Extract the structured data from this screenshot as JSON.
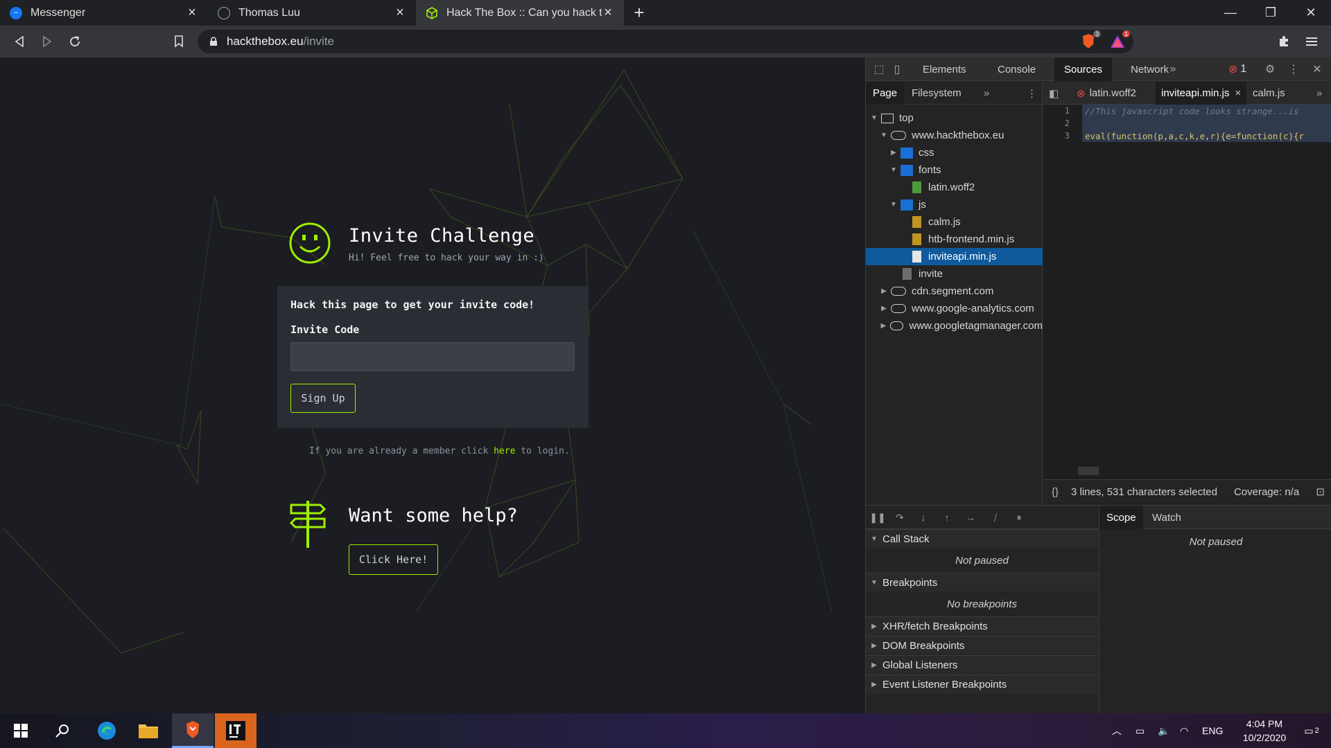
{
  "browser": {
    "tabs": [
      {
        "title": "Messenger",
        "active": false
      },
      {
        "title": "Thomas Luu",
        "active": false
      },
      {
        "title": "Hack The Box :: Can you hack this i",
        "active": true
      }
    ],
    "url_host": "hackthebox.eu",
    "url_path": "/invite",
    "shield_badge": "3",
    "rewards_badge": "1"
  },
  "page": {
    "invite_title": "Invite Challenge",
    "invite_subtitle": "Hi! Feel free to hack your way in :)",
    "card_heading": "Hack this page to get your invite code!",
    "code_label": "Invite Code",
    "code_value": "",
    "signup_label": "Sign Up",
    "login_prefix": "If you are already a member click ",
    "login_link": "here",
    "login_suffix": " to login.",
    "help_title": "Want some help?",
    "help_button": "Click Here!",
    "accent_color": "#9fef00"
  },
  "devtools": {
    "tabs": [
      "Elements",
      "Console",
      "Sources",
      "Network"
    ],
    "active_tab": "Sources",
    "error_count": "1",
    "navigator_tabs": [
      "Page",
      "Filesystem"
    ],
    "tree": {
      "top": "top",
      "domain": "www.hackthebox.eu",
      "css": "css",
      "fonts": "fonts",
      "font_file": "latin.woff2",
      "js": "js",
      "js_files": [
        "calm.js",
        "htb-frontend.min.js",
        "inviteapi.min.js"
      ],
      "invite": "invite",
      "other_domains": [
        "cdn.segment.com",
        "www.google-analytics.com",
        "www.googletagmanager.com"
      ]
    },
    "editor_tabs": [
      "latin.woff2",
      "inviteapi.min.js",
      "calm.js"
    ],
    "code_lines": [
      "//This javascript code looks strange...is",
      "",
      "eval(function(p,a,c,k,e,r){e=function(c){r"
    ],
    "line_numbers": [
      "1",
      "2",
      "3"
    ],
    "status_selection": "3 lines, 531 characters selected",
    "status_coverage": "Coverage: n/a",
    "sections": {
      "call_stack": "Call Stack",
      "call_stack_body": "Not paused",
      "breakpoints": "Breakpoints",
      "breakpoints_body": "No breakpoints",
      "xhr": "XHR/fetch Breakpoints",
      "dom": "DOM Breakpoints",
      "global": "Global Listeners",
      "event": "Event Listener Breakpoints"
    },
    "scope_tabs": [
      "Scope",
      "Watch"
    ],
    "scope_body": "Not paused"
  },
  "taskbar": {
    "time": "4:04 PM",
    "date": "10/2/2020",
    "lang": "ENG",
    "notifications": "2"
  }
}
